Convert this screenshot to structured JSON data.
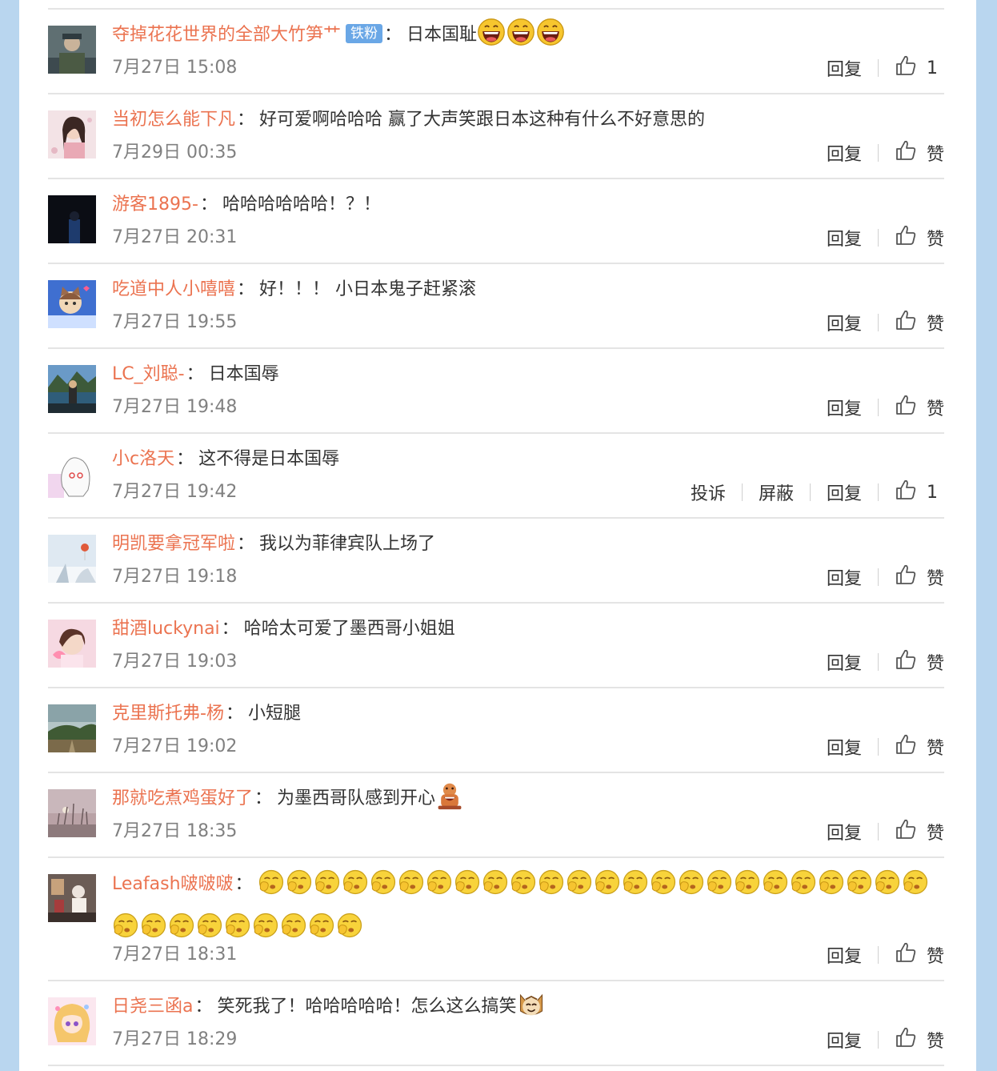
{
  "actions": {
    "reply": "回复",
    "like": "赞",
    "report": "投诉",
    "block": "屏蔽"
  },
  "comments": [
    {
      "user": "夺掉花花世界的全部大竹笋艹",
      "badge": "铁粉",
      "text": "日本国耻",
      "emoji": [
        {
          "type": "laugh",
          "count": 3
        }
      ],
      "time": "7月27日 15:08",
      "likes": "1",
      "avatar": "avatar-soldier-photo"
    },
    {
      "user": "当初怎么能下凡",
      "text": "好可爱啊哈哈哈 赢了大声笑跟日本这种有什么不好意思的",
      "time": "7月29日 00:35",
      "likes": "赞",
      "avatar": "avatar-girl-photo"
    },
    {
      "user": "游客1895-",
      "text": "哈哈哈哈哈哈！？！",
      "time": "7月27日 20:31",
      "likes": "赞",
      "avatar": "avatar-dark-photo"
    },
    {
      "user": "吃道中人小嘻嘻",
      "text": "好！！！ 小日本鬼子赶紧滚",
      "time": "7月27日 19:55",
      "likes": "赞",
      "avatar": "avatar-cartoon-cat"
    },
    {
      "user": "LC_刘聪-",
      "text": "日本国辱",
      "time": "7月27日 19:48",
      "likes": "赞",
      "avatar": "avatar-lake-photo"
    },
    {
      "user": "小c洛天",
      "text": "这不得是日本国辱",
      "time": "7月27日 19:42",
      "likes": "1",
      "extra": true,
      "avatar": "avatar-anime-sketch"
    },
    {
      "user": "明凯要拿冠军啦",
      "text": "我以为菲律宾队上场了",
      "time": "7月27日 19:18",
      "likes": "赞",
      "avatar": "avatar-winter-photo"
    },
    {
      "user": "甜酒luckynai",
      "text": "哈哈太可爱了墨西哥小姐姐",
      "time": "7月27日 19:03",
      "likes": "赞",
      "avatar": "avatar-pink-girl-photo"
    },
    {
      "user": "克里斯托弗-杨",
      "text": "小短腿",
      "time": "7月27日 19:02",
      "likes": "赞",
      "avatar": "avatar-landscape-photo"
    },
    {
      "user": "那就吃煮鸡蛋好了",
      "text": "为墨西哥队感到开心",
      "emoji": [
        {
          "type": "gingerbread",
          "count": 1
        }
      ],
      "time": "7月27日 18:35",
      "likes": "赞",
      "avatar": "avatar-reeds-photo"
    },
    {
      "user": "Leafash啵啵啵",
      "text": "",
      "emoji": [
        {
          "type": "yawn",
          "count": 33
        }
      ],
      "time": "7月27日 18:31",
      "likes": "赞",
      "tall": true,
      "avatar": "avatar-room-photo"
    },
    {
      "user": "日尧三函a",
      "text": "笑死我了！哈哈哈哈哈！怎么这么搞笑",
      "emoji": [
        {
          "type": "cat",
          "count": 1
        }
      ],
      "time": "7月27日 18:29",
      "likes": "赞",
      "avatar": "avatar-anime-girl"
    }
  ]
}
